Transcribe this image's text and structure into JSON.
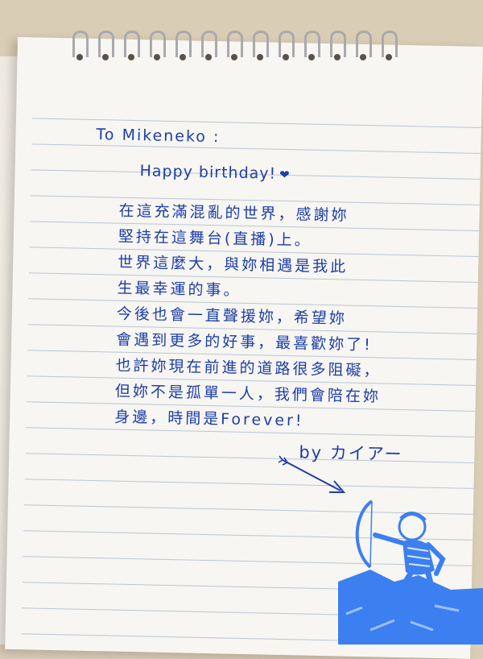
{
  "letter": {
    "greeting": "To Mikeneko :",
    "birthday_wish": "Happy birthday!",
    "body_lines": [
      "在這充滿混亂的世界，感謝妳",
      "堅持在這舞台(直播)上。",
      "世界這麼大，與妳相遇是我此",
      "生最幸運的事。",
      "今後也會一直聲援妳，希望妳",
      "會遇到更多的好事，最喜歡妳了!",
      "也許妳現在前進的道路很多阻礙，",
      "但妳不是孤單一人，我們會陪在妳",
      "身邊，時間是Forever!"
    ],
    "signature": "by カイアー"
  },
  "ink_color": "#1e3ea8",
  "stamp_color": "#3c7ff0",
  "icons": {
    "heart": "heart-icon",
    "arrow": "arrow-doodle",
    "stamp": "archer-stamp"
  }
}
